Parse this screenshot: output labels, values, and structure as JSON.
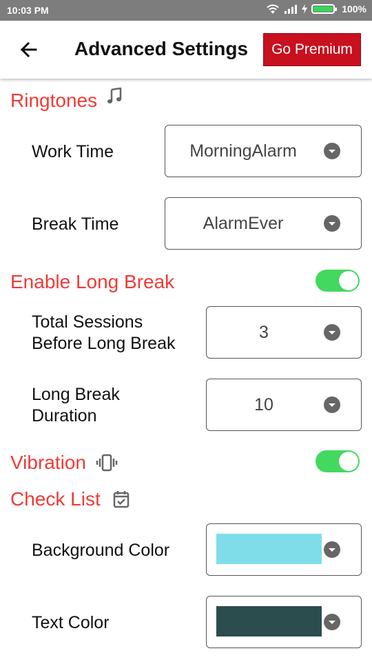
{
  "status_bar": {
    "time": "10:03 PM",
    "battery_percent": "100%",
    "battery_level": 1.0,
    "icons": [
      "wifi-icon",
      "signal-icon",
      "charging-icon",
      "battery-icon"
    ]
  },
  "app_bar": {
    "title": "Advanced Settings",
    "premium_label": "Go Premium",
    "back_icon": "arrow-left-icon"
  },
  "ringtones": {
    "title": "Ringtones",
    "icon": "music-note-icon",
    "work_time_label": "Work Time",
    "work_time_value": "MorningAlarm",
    "break_time_label": "Break Time",
    "break_time_value": "AlarmEver"
  },
  "long_break": {
    "title": "Enable Long Break",
    "enabled": true,
    "sessions_label_line1": "Total Sessions",
    "sessions_label_line2": "Before Long Break",
    "sessions_value": "3",
    "duration_label_line1": "Long Break",
    "duration_label_line2": "Duration",
    "duration_value": "10"
  },
  "vibration": {
    "title": "Vibration",
    "icon": "vibration-icon",
    "enabled": true
  },
  "check_list": {
    "title": "Check List",
    "icon": "calendar-check-icon",
    "background_color_label": "Background Color",
    "background_color": "#7fdde9",
    "text_color_label": "Text Color",
    "text_color": "#2c4d4d"
  },
  "colors": {
    "accent": "#ef3b36",
    "premium": "#c8101f",
    "toggle_on": "#43d85f",
    "status_bar": "#7d7d7d"
  }
}
